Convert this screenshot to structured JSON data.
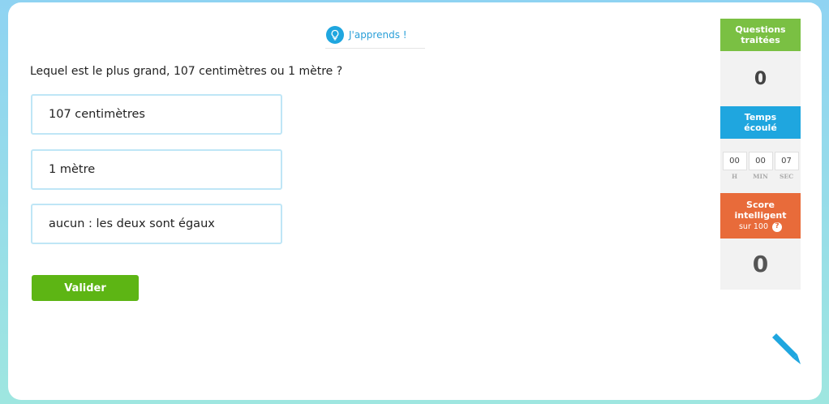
{
  "learn_button": {
    "label": "J'apprends !",
    "icon": "lightbulb-icon"
  },
  "question": {
    "text": "Lequel est le plus grand, 107 centimètres ou 1 mètre ?"
  },
  "options": [
    {
      "label": "107 centimètres"
    },
    {
      "label": "1 mètre"
    },
    {
      "label": "aucun : les deux sont égaux"
    }
  ],
  "validate_button": {
    "label": "Valider"
  },
  "sidebar": {
    "questions": {
      "title_line1": "Questions",
      "title_line2": "traitées",
      "value": "0"
    },
    "time": {
      "title_line1": "Temps",
      "title_line2": "écoulé",
      "hours": "00",
      "minutes": "00",
      "seconds": "07",
      "label_h": "H",
      "label_min": "MIN",
      "label_sec": "SEC"
    },
    "score": {
      "title_line1": "Score",
      "title_line2": "intelligent",
      "subtitle": "sur 100",
      "help_icon": "?",
      "value": "0"
    }
  },
  "colors": {
    "green": "#7ac043",
    "blue": "#1fa6df",
    "orange": "#e86b3a",
    "validate": "#5db514"
  },
  "pencil": {
    "icon": "pencil-icon"
  }
}
